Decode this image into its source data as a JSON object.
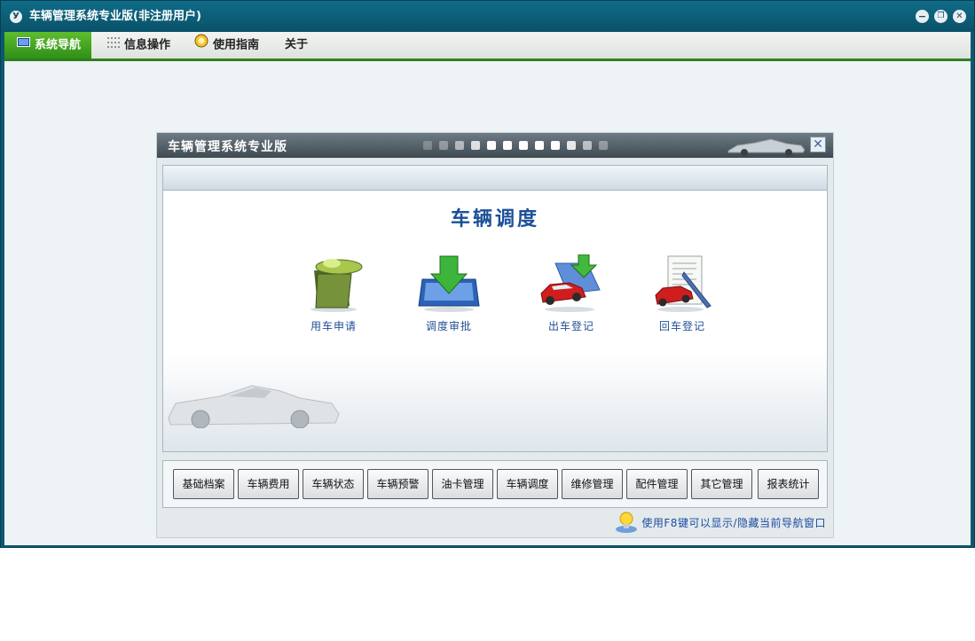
{
  "window": {
    "title": "车辆管理系统专业版(非注册用户)",
    "app_icon_glyph": "У",
    "controls": {
      "minimize": "−",
      "restore": "❐",
      "close": "✕"
    }
  },
  "menu": [
    {
      "label": "系统导航",
      "icon": "monitor-icon",
      "active": true
    },
    {
      "label": "信息操作",
      "icon": "grid-icon",
      "active": false
    },
    {
      "label": "使用指南",
      "icon": "help-coin-icon",
      "active": false
    },
    {
      "label": "关于",
      "icon": "",
      "active": false
    }
  ],
  "dialog": {
    "title": "车辆管理系统专业版",
    "close_glyph": "✕",
    "section_title": "车辆调度",
    "tiles": [
      {
        "label": "用车申请",
        "icon": "phone-folder-icon"
      },
      {
        "label": "调度审批",
        "icon": "download-tray-icon"
      },
      {
        "label": "出车登记",
        "icon": "car-arrow-icon"
      },
      {
        "label": "回车登记",
        "icon": "car-document-icon"
      }
    ],
    "nav_buttons": [
      "基础档案",
      "车辆费用",
      "车辆状态",
      "车辆预警",
      "油卡管理",
      "车辆调度",
      "维修管理",
      "配件管理",
      "其它管理",
      "报表统计"
    ],
    "tip": "使用F8键可以显示/隐藏当前导航窗口"
  },
  "colors": {
    "title_bar": "#0a5169",
    "menu_active": "#3f9f1f",
    "section_title": "#1b4f99",
    "label_text": "#1f4f95"
  }
}
